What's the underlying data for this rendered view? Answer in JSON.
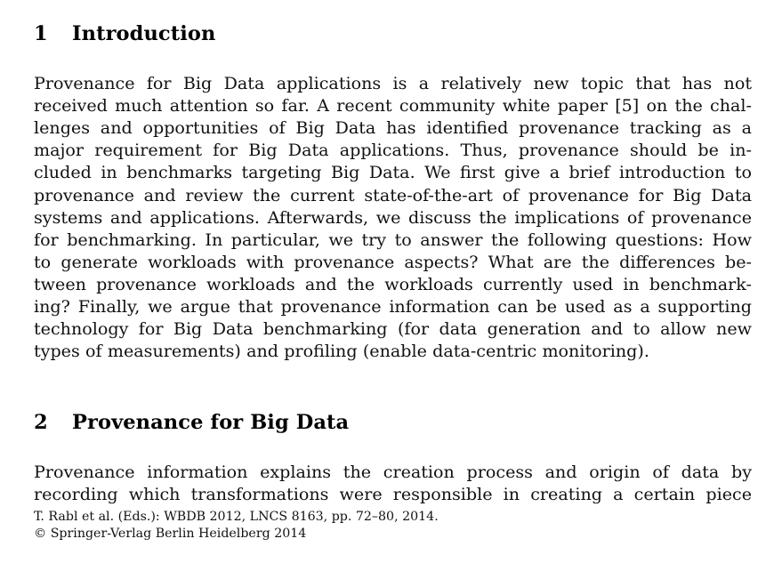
{
  "document": {
    "sections": [
      {
        "number": "1",
        "title": "Introduction",
        "paragraph_lines": [
          "Provenance for Big Data applications is a relatively new topic that has not",
          "received much attention so far. A recent community white paper [5] on the chal-",
          "lenges and opportunities of Big Data has identified provenance tracking as a",
          "major requirement for Big Data applications. Thus, provenance should be in-",
          "cluded in benchmarks targeting Big Data. We first give a brief introduction to",
          "provenance and review the current state-of-the-art of provenance for Big Data",
          "systems and applications. Afterwards, we discuss the implications of provenance",
          "for benchmarking. In particular, we try to answer the following questions: How",
          "to generate workloads with provenance aspects? What are the differences be-",
          "tween provenance workloads and the workloads currently used in benchmark-",
          "ing? Finally, we argue that provenance information can be used as a supporting",
          "technology for Big Data benchmarking (for data generation and to allow new",
          "types of measurements) and profiling (enable data-centric monitoring)."
        ]
      },
      {
        "number": "2",
        "title": "Provenance for Big Data",
        "paragraph_lines": [
          "Provenance information explains the creation process and origin of data by",
          "recording which transformations were responsible in creating a certain piece"
        ]
      }
    ],
    "footnote": {
      "line1": "T. Rabl et al. (Eds.): WBDB 2012, LNCS 8163, pp. 72–80, 2014.",
      "copyright_symbol": "©",
      "line2": "Springer-Verlag Berlin Heidelberg 2014"
    },
    "colors": {
      "page_background": "#ffffff",
      "text": "#111111",
      "heading": "#000000"
    }
  }
}
